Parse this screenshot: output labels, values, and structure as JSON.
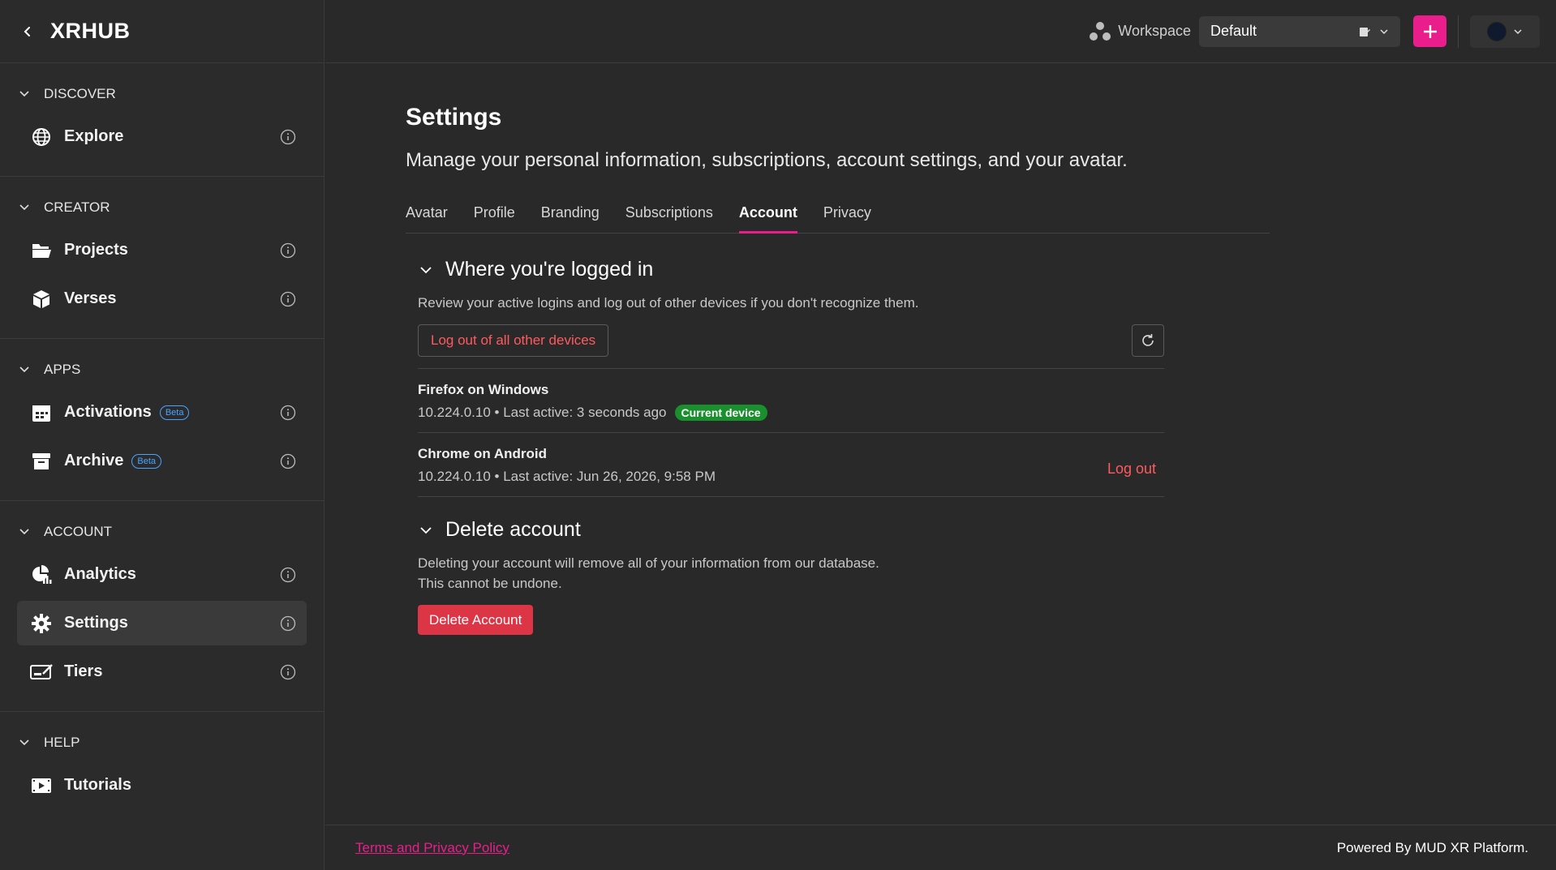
{
  "app": {
    "name": "XRHUB"
  },
  "sidebar": {
    "sections": [
      {
        "title": "DISCOVER",
        "items": [
          {
            "label": "Explore",
            "icon": "globe-icon"
          }
        ]
      },
      {
        "title": "CREATOR",
        "items": [
          {
            "label": "Projects",
            "icon": "folder-icon"
          },
          {
            "label": "Verses",
            "icon": "cube-icon"
          }
        ]
      },
      {
        "title": "APPS",
        "items": [
          {
            "label": "Activations",
            "icon": "calendar-icon",
            "badge": "Beta"
          },
          {
            "label": "Archive",
            "icon": "archive-icon",
            "badge": "Beta"
          }
        ]
      },
      {
        "title": "ACCOUNT",
        "items": [
          {
            "label": "Analytics",
            "icon": "analytics-icon"
          },
          {
            "label": "Settings",
            "icon": "gear-icon",
            "active": true
          },
          {
            "label": "Tiers",
            "icon": "tiers-icon"
          }
        ]
      },
      {
        "title": "HELP",
        "items": [
          {
            "label": "Tutorials",
            "icon": "video-icon"
          }
        ]
      }
    ]
  },
  "topbar": {
    "workspace_label": "Workspace",
    "workspace_value": "Default",
    "accent_color": "#e91e8c"
  },
  "page": {
    "title": "Settings",
    "subtitle": "Manage your personal information, subscriptions, account settings, and your avatar.",
    "tabs": [
      "Avatar",
      "Profile",
      "Branding",
      "Subscriptions",
      "Account",
      "Privacy"
    ],
    "active_tab": "Account"
  },
  "logins": {
    "title": "Where you're logged in",
    "description": "Review your active logins and log out of other devices if you don't recognize them.",
    "logout_all_label": "Log out of all other devices",
    "devices": [
      {
        "name": "Firefox on Windows",
        "meta": "10.224.0.10 • Last active: 3 seconds ago",
        "badge": "Current device"
      },
      {
        "name": "Chrome on Android",
        "meta": "10.224.0.10 • Last active: Jun 26, 2026, 9:58 PM",
        "action": "Log out"
      }
    ]
  },
  "delete": {
    "title": "Delete account",
    "line1": "Deleting your account will remove all of your information from our database.",
    "line2": "This cannot be undone.",
    "button": "Delete Account"
  },
  "footer": {
    "terms": "Terms and Privacy Policy",
    "powered": "Powered By MUD XR Platform."
  }
}
